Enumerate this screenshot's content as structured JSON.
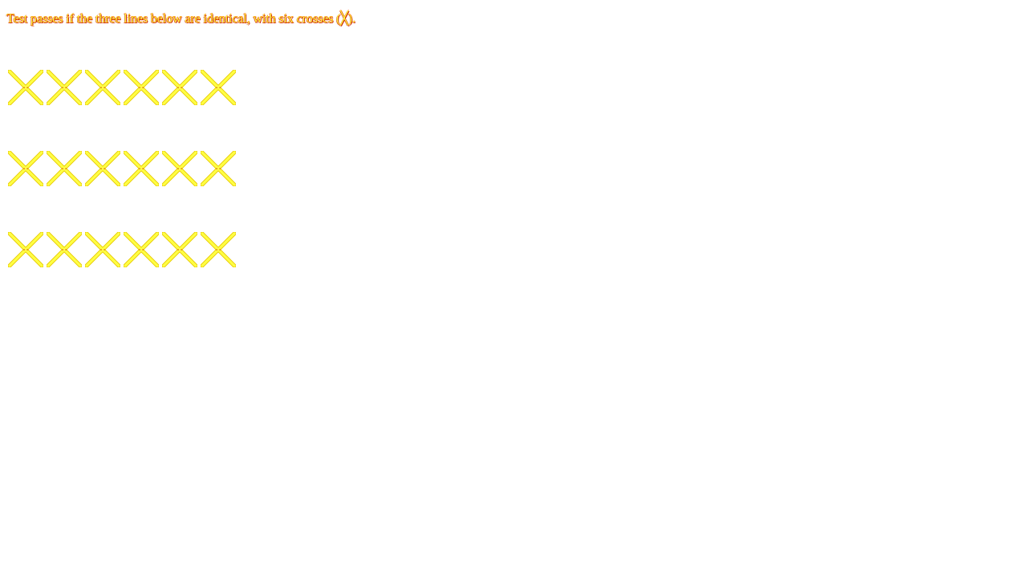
{
  "instructions": "Test passes if the three lines below are identical, with six crosses (╳).",
  "glyph": "╳",
  "colors": {
    "cross_fill": "#ffff44",
    "cross_edge": "#e6c800",
    "cross_center": "#cc2200",
    "text_fill": "#ffff44",
    "text_shadow": "#cc2200"
  },
  "rows": [
    {
      "crosses": 6
    },
    {
      "crosses": 6
    },
    {
      "crosses": 6
    }
  ]
}
